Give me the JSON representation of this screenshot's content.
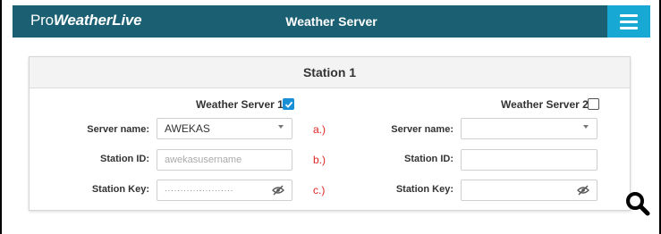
{
  "header": {
    "logo_light": "Pro",
    "logo_bold": "WeatherLive",
    "title": "Weather Server",
    "menu_icon": "hamburger-menu-icon"
  },
  "card": {
    "title": "Station 1"
  },
  "server1": {
    "checkbox_label": "Weather Server 1",
    "checked": true,
    "server_name_label": "Server name:",
    "server_name_value": "AWEKAS",
    "station_id_label": "Station ID:",
    "station_id_placeholder": "awekasusername",
    "station_key_label": "Station Key:",
    "station_key_value": "······················"
  },
  "markers": {
    "a": "a.)",
    "b": "b.)",
    "c": "c.)"
  },
  "server2": {
    "checkbox_label": "Weather Server 2",
    "checked": false,
    "server_name_label": "Server name:",
    "server_name_value": "",
    "station_id_label": "Station ID:",
    "station_id_value": "",
    "station_key_label": "Station Key:",
    "station_key_value": ""
  },
  "colors": {
    "header_bg": "#1b5f72",
    "menu_bg": "#17a8d4",
    "checkbox_checked": "#1a8fd8",
    "marker_red": "#e02424"
  },
  "icons": {
    "search": "search-icon",
    "visibility": "eye-off-icon",
    "dropdown": "chevron-down-icon",
    "checkmark": "check-icon"
  }
}
